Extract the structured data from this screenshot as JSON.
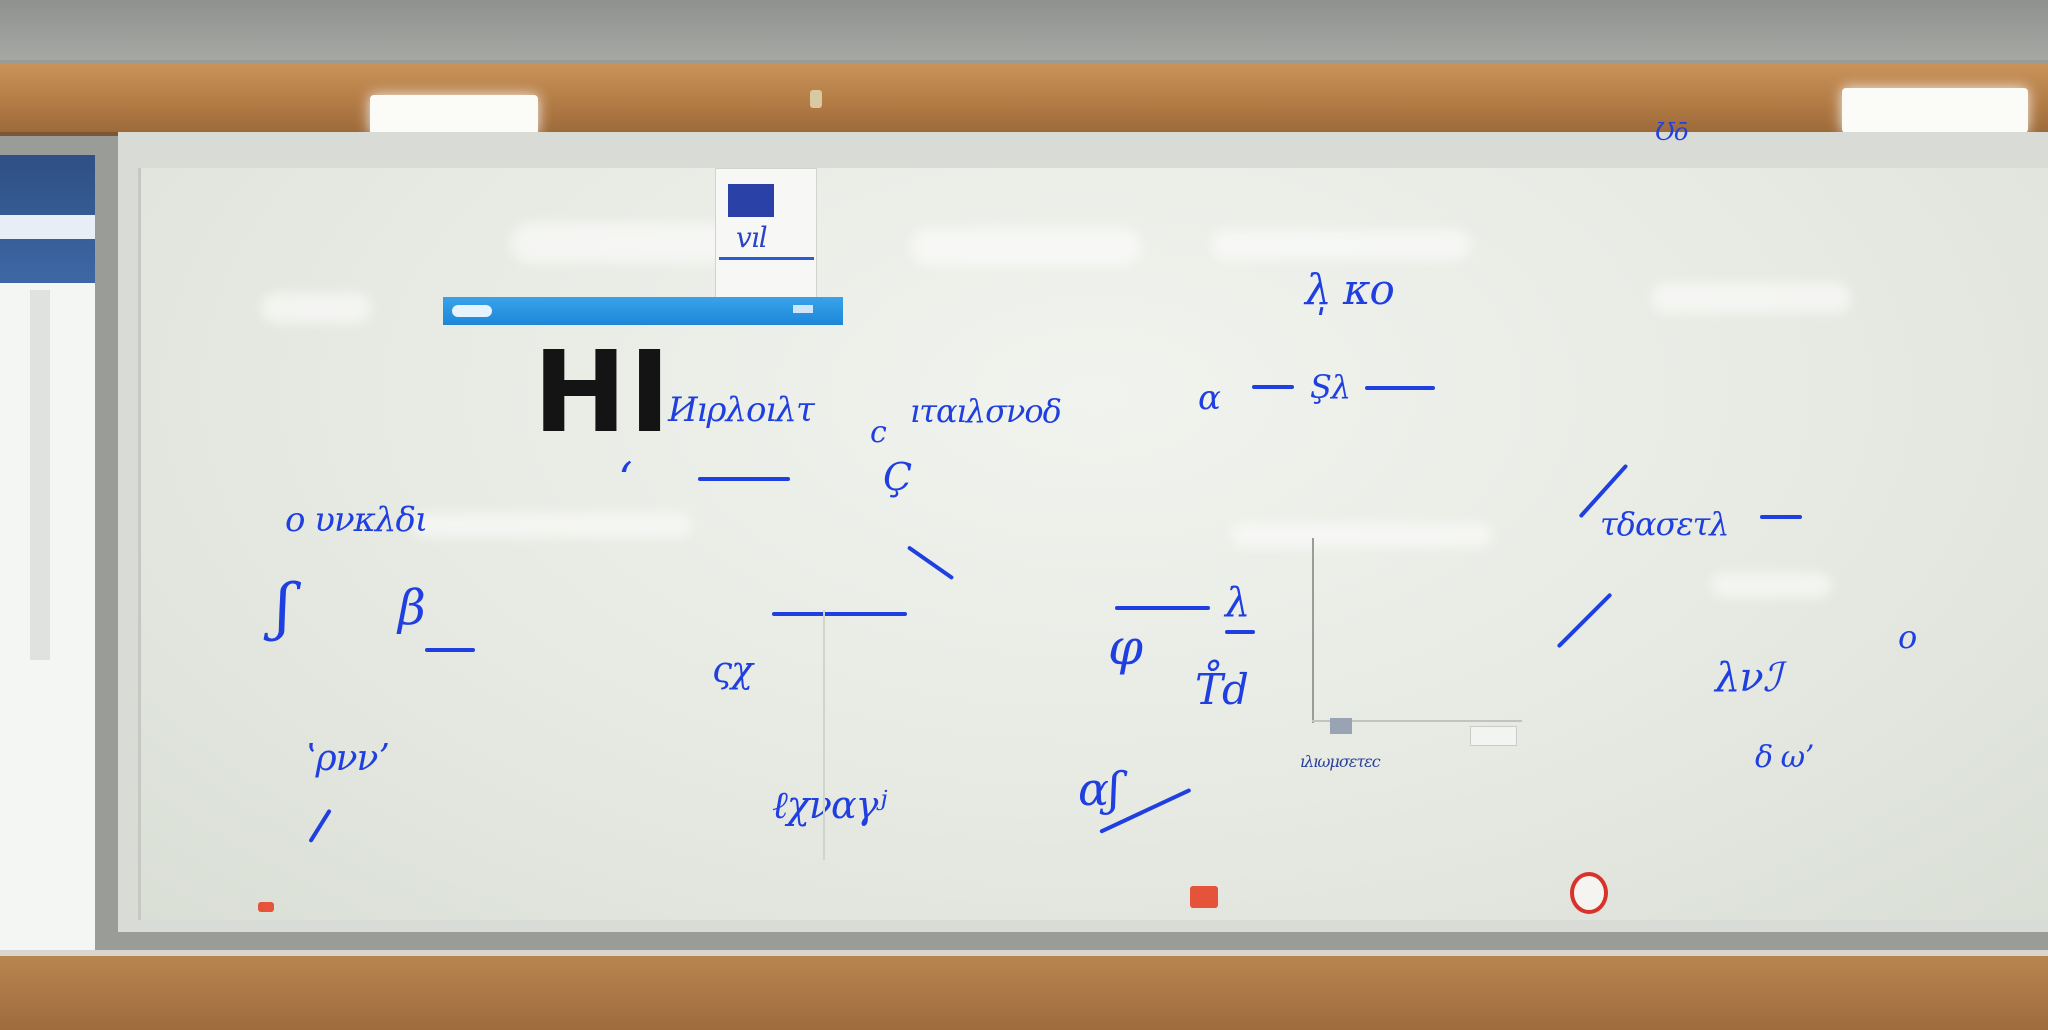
{
  "scene": {
    "description_colors": {
      "wall": "#9a9c98",
      "rail": "#b27a44",
      "board": "#eef0eb",
      "marker_ink": "#1f3fe0",
      "black_marker": "#141414",
      "display_bar": "#1e86d8"
    }
  },
  "whiteboard": {
    "big_text": "HI",
    "top_right_label": "Ʊō",
    "scribbles": [
      "vıl",
      "Иıρλοıλτ",
      "ıταıλσνοδ",
      "c",
      "λ̩ κο",
      "ɑ",
      "Şλ",
      "o υνκλδι",
      "ʻ",
      "Ç",
      "τδασετλ",
      "ʃ",
      "β",
      "ʽρννʼ",
      "ςχ",
      "ℓχναγʲ",
      "λνℐ",
      "o",
      "δ ωʼ",
      "φ",
      "λ",
      "T̊d",
      "ɑʃ",
      "ıλıωμσετεc"
    ]
  }
}
